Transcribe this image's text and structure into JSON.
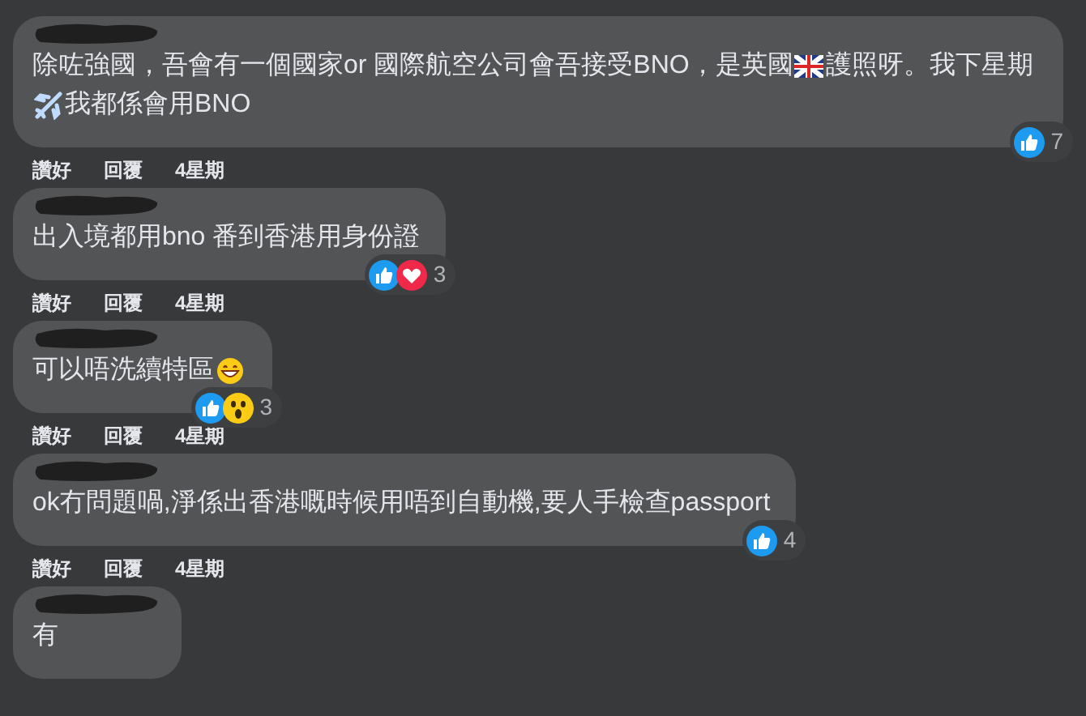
{
  "comments": [
    {
      "segments": [
        {
          "kind": "text",
          "text": "除咗強國，吾會有一個國家or 國際航空公司會吾接受BNO，是英國"
        },
        {
          "kind": "flag"
        },
        {
          "kind": "text",
          "text": "護照呀。我下星期"
        },
        {
          "kind": "plane"
        },
        {
          "kind": "text",
          "text": "我都係會用BNO"
        }
      ],
      "reactions": [
        {
          "kind": "like"
        }
      ],
      "reaction_count": "7",
      "actions": [
        "讚好",
        "回覆",
        "4星期"
      ]
    },
    {
      "segments": [
        {
          "kind": "text",
          "text": "出入境都用bno 番到香港用身份證"
        }
      ],
      "reactions": [
        {
          "kind": "like"
        },
        {
          "kind": "love"
        }
      ],
      "reaction_count": "3",
      "actions": [
        "讚好",
        "回覆",
        "4星期"
      ]
    },
    {
      "segments": [
        {
          "kind": "text",
          "text": "可以唔洗續特區"
        },
        {
          "kind": "grin"
        }
      ],
      "reactions": [
        {
          "kind": "like"
        },
        {
          "kind": "wow"
        }
      ],
      "reaction_count": "3",
      "actions": [
        "讚好",
        "回覆",
        "4星期"
      ]
    },
    {
      "segments": [
        {
          "kind": "text",
          "text": "ok冇問題喎,淨係出香港嘅時候用唔到自動機,要人手檢查passport"
        }
      ],
      "reactions": [
        {
          "kind": "like"
        }
      ],
      "reaction_count": "4",
      "actions": [
        "讚好",
        "回覆",
        "4星期"
      ]
    },
    {
      "segments": [
        {
          "kind": "text",
          "text": "有"
        }
      ]
    }
  ]
}
